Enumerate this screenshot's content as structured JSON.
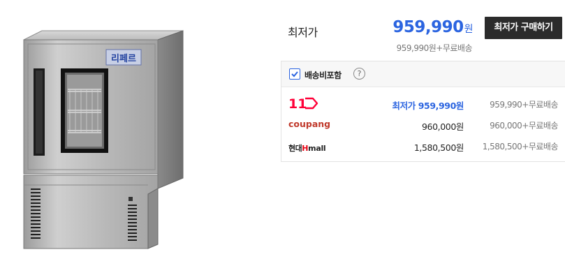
{
  "product": {
    "image_brand_text": "리페르"
  },
  "summary": {
    "lowest_label": "최저가",
    "price": "959,990",
    "currency": "원",
    "price_with_shipping": "959,990원+무료배송",
    "buy_button_label": "최저가 구매하기"
  },
  "shipping_option": {
    "checked": true,
    "label": "배송비포함",
    "help_icon": "?"
  },
  "malls": [
    {
      "name": "11번가",
      "logo_text": "11",
      "icon": "11st-logo",
      "price_label": "최저가 959,990원",
      "shipping": "959,990+무료배송",
      "best": true
    },
    {
      "name": "coupang",
      "logo_text": "coupang",
      "icon": "coupang-logo",
      "price_label": "960,000원",
      "shipping": "960,000+무료배송",
      "best": false
    },
    {
      "name": "현대Hmall",
      "logo_text_prefix": "현대",
      "logo_text_suffix": "Hmall",
      "icon": "hmall-logo",
      "price_label": "1,580,500원",
      "shipping": "1,580,500+무료배송",
      "best": false
    }
  ],
  "colors": {
    "accent_blue": "#2b64e0",
    "button_dark": "#2b2b2b",
    "eleven_red": "#ff0038",
    "hmall_red": "#e60012"
  }
}
